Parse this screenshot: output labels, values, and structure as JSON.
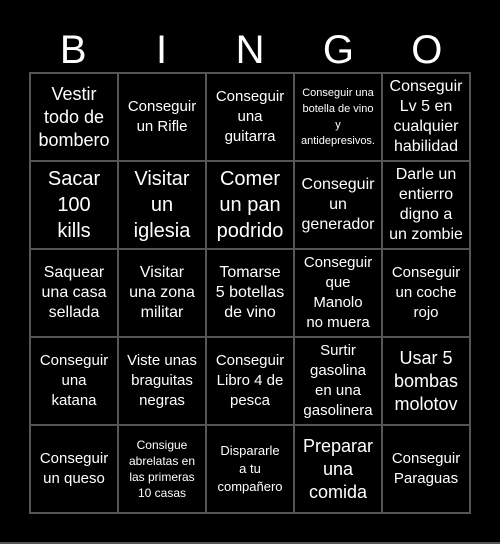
{
  "header": {
    "letters": [
      "B",
      "I",
      "N",
      "G",
      "O"
    ]
  },
  "board": {
    "cells": [
      "Vestir\ntodo de\nbombero",
      "Conseguir\nun Rifle",
      "Conseguir\nuna\nguitarra",
      "Conseguir una\nbotella de vino\ny\nantidepresivos.",
      "Conseguir\nLv 5 en\ncualquier\nhabilidad",
      "Sacar\n100\nkills",
      "Visitar\nun\niglesia",
      "Comer\nun pan\npodrido",
      "Conseguir\nun\ngenerador",
      "Darle un\nentierro\ndigno a\nun zombie",
      "Saquear\nuna casa\nsellada",
      "Visitar\nuna zona\nmilitar",
      "Tomarse\n5 botellas\nde vino",
      "Conseguir\nque\nManolo\nno muera",
      "Conseguir\nun coche\nrojo",
      "Conseguir\nuna\nkatana",
      "Viste unas\nbraguitas\nnegras",
      "Conseguir\nLibro 4 de\npesca",
      "Surtir\ngasolina\nen una\ngasolinera",
      "Usar 5\nbombas\nmolotov",
      "Conseguir\nun queso",
      "Consigue\nabrelatas en\nlas primeras\n10 casas",
      "Dispararle\na tu\ncompañero",
      "Preparar\nuna\ncomida",
      "Conseguir\nParaguas"
    ]
  }
}
